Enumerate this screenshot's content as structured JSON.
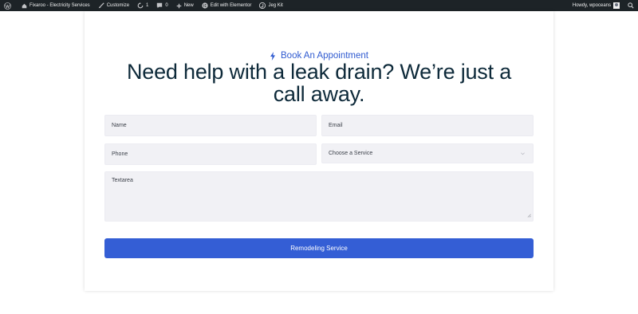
{
  "admin_bar": {
    "site_name": "Fixaroo - Electricity Services",
    "customize_label": "Customize",
    "updates_count": "1",
    "comments_count": "0",
    "new_label": "New",
    "elementor_label": "Edit with Elementor",
    "jegkit_label": "Jeg Kit",
    "greeting": "Howdy, wpoceans"
  },
  "appointment": {
    "subtitle": "Book An Appointment",
    "heading": "Need help with a leak drain? We’re just a call away."
  },
  "form": {
    "name_placeholder": "Name",
    "email_placeholder": "Email",
    "phone_placeholder": "Phone",
    "service_selected": "Choose a Service",
    "textarea_placeholder": "Textarea",
    "submit_label": "Remodeling Service"
  },
  "colors": {
    "accent": "#345ed5",
    "heading": "#0e2a3a",
    "admin_bar": "#1d2327",
    "field_bg": "#f1f1f5"
  },
  "icons": [
    "wordpress-icon",
    "customize-brush-icon",
    "updates-icon",
    "comments-icon",
    "plus-icon",
    "elementor-icon",
    "jegkit-icon",
    "search-icon",
    "bolt-icon",
    "chevron-down-icon",
    "resize-grip-icon"
  ]
}
